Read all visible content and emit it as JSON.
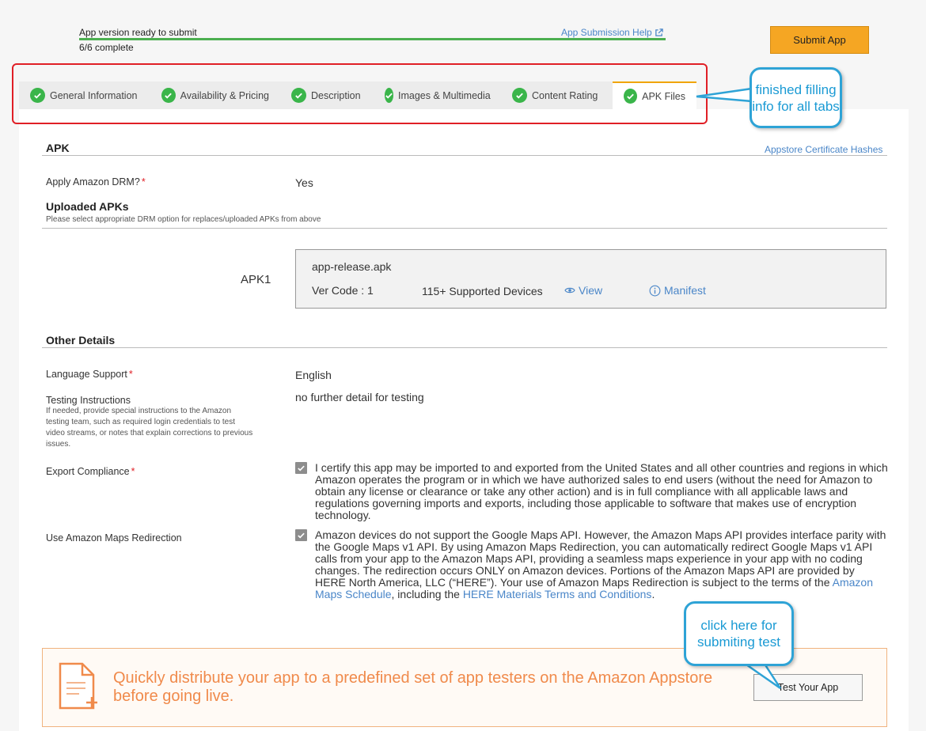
{
  "header": {
    "status_title": "App version ready to submit",
    "progress_count": "6/6 complete",
    "progress_fraction": 1.0,
    "help_link": "App Submission Help",
    "submit_button": "Submit App"
  },
  "tabs": [
    {
      "label": "General Information",
      "icon": "check-circle-icon"
    },
    {
      "label": "Availability & Pricing",
      "icon": "check-circle-icon"
    },
    {
      "label": "Description",
      "icon": "check-circle-icon"
    },
    {
      "label": "Images & Multimedia",
      "icon": "check-circle-icon"
    },
    {
      "label": "Content Rating",
      "icon": "check-circle-icon"
    },
    {
      "label": "APK Files",
      "icon": "check-circle-icon",
      "active": true
    }
  ],
  "callouts": {
    "tabs": "finished filling info for all tabs",
    "test": "click here for submiting test"
  },
  "apk_section": {
    "title": "APK",
    "cert_link": "Appstore Certificate Hashes",
    "drm_label": "Apply Amazon DRM?",
    "required_mark": "*",
    "drm_value": "Yes",
    "uploaded_title": "Uploaded APKs",
    "uploaded_note": "Please select appropriate DRM option for replaces/uploaded APKs from above",
    "apk_label": "APK1",
    "apk_file": "app-release.apk",
    "ver_code": "Ver Code : 1",
    "devices": "115+ Supported Devices",
    "view_link": "View",
    "manifest_link": "Manifest"
  },
  "other_details": {
    "title": "Other Details",
    "language_label": "Language Support",
    "language_value": "English",
    "testing_label": "Testing Instructions",
    "testing_help": "If needed, provide special instructions to the Amazon testing team, such as required login credentials to test video streams, or notes that explain corrections to previous issues.",
    "testing_value": "no further detail for testing",
    "export_label": "Export Compliance",
    "export_text": "I certify this app may be imported to and exported from the United States and all other countries and regions in which Amazon operates the program or in which we have authorized sales to end users (without the need for Amazon to obtain any license or clearance or take any other action) and is in full compliance with all applicable laws and regulations governing imports and exports, including those applicable to software that makes use of encryption technology.",
    "maps_label": "Use Amazon Maps Redirection",
    "maps_text_1": "Amazon devices do not support the Google Maps API. However, the Amazon Maps API provides interface parity with the Google Maps v1 API. By using Amazon Maps Redirection, you can automatically redirect Google Maps v1 API calls from your app to the Amazon Maps API, providing a seamless maps experience in your app with no coding changes. The redirection occurs ONLY on Amazon devices. Portions of the Amazon Maps API are provided by HERE North America, LLC (“HERE”). Your use of Amazon Maps Redirection is subject to the terms of the ",
    "maps_link_1": "Amazon Maps Schedule",
    "maps_text_2": ", including the ",
    "maps_link_2": "HERE Materials Terms and Conditions",
    "maps_text_3": "."
  },
  "promo": {
    "text": "Quickly distribute your app to a predefined set of app testers on the Amazon Appstore before going live.",
    "button": "Test Your App"
  }
}
